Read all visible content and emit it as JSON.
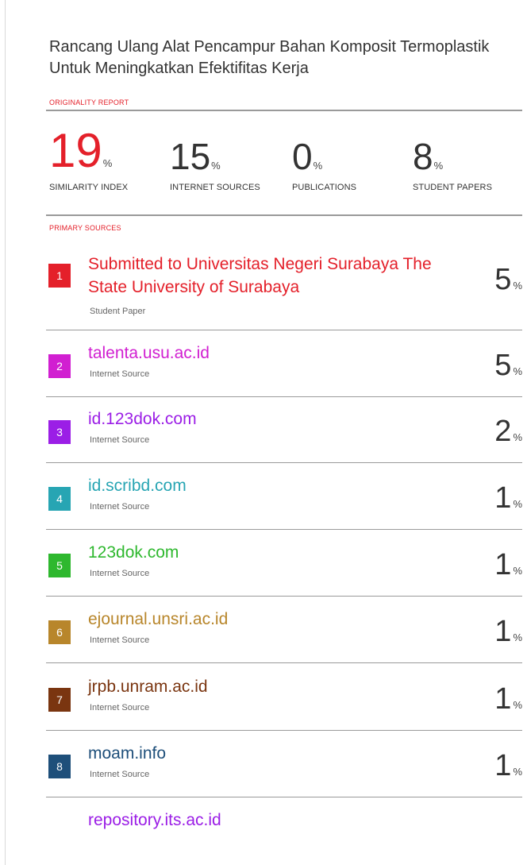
{
  "document": {
    "title": "Rancang Ulang Alat Pencampur Bahan Komposit Termoplastik Untuk Meningkatkan Efektifitas Kerja"
  },
  "report": {
    "originality_label": "ORIGINALITY REPORT",
    "primary_sources_label": "PRIMARY SOURCES",
    "percent_sign": "%",
    "stats": [
      {
        "value": "19",
        "label": "SIMILARITY INDEX"
      },
      {
        "value": "15",
        "label": "INTERNET SOURCES"
      },
      {
        "value": "0",
        "label": "PUBLICATIONS"
      },
      {
        "value": "8",
        "label": "STUDENT PAPERS"
      }
    ]
  },
  "sources": [
    {
      "rank": "1",
      "title": "Submitted to Universitas Negeri Surabaya The State University of Surabaya",
      "type": "Student Paper",
      "percent": "5",
      "color": "#e4202a"
    },
    {
      "rank": "2",
      "title": "talenta.usu.ac.id",
      "type": "Internet Source",
      "percent": "5",
      "color": "#d11fd1"
    },
    {
      "rank": "3",
      "title": "id.123dok.com",
      "type": "Internet Source",
      "percent": "2",
      "color": "#9b1ee6"
    },
    {
      "rank": "4",
      "title": "id.scribd.com",
      "type": "Internet Source",
      "percent": "1",
      "color": "#27a5b3"
    },
    {
      "rank": "5",
      "title": "123dok.com",
      "type": "Internet Source",
      "percent": "1",
      "color": "#2eb82e"
    },
    {
      "rank": "6",
      "title": "ejournal.unsri.ac.id",
      "type": "Internet Source",
      "percent": "1",
      "color": "#b8862b"
    },
    {
      "rank": "7",
      "title": "jrpb.unram.ac.id",
      "type": "Internet Source",
      "percent": "1",
      "color": "#7a3510"
    },
    {
      "rank": "8",
      "title": "moam.info",
      "type": "Internet Source",
      "percent": "1",
      "color": "#1e4f7a"
    }
  ],
  "partial_source": {
    "title": "repository.its.ac.id",
    "color": "#9b1ee6"
  }
}
